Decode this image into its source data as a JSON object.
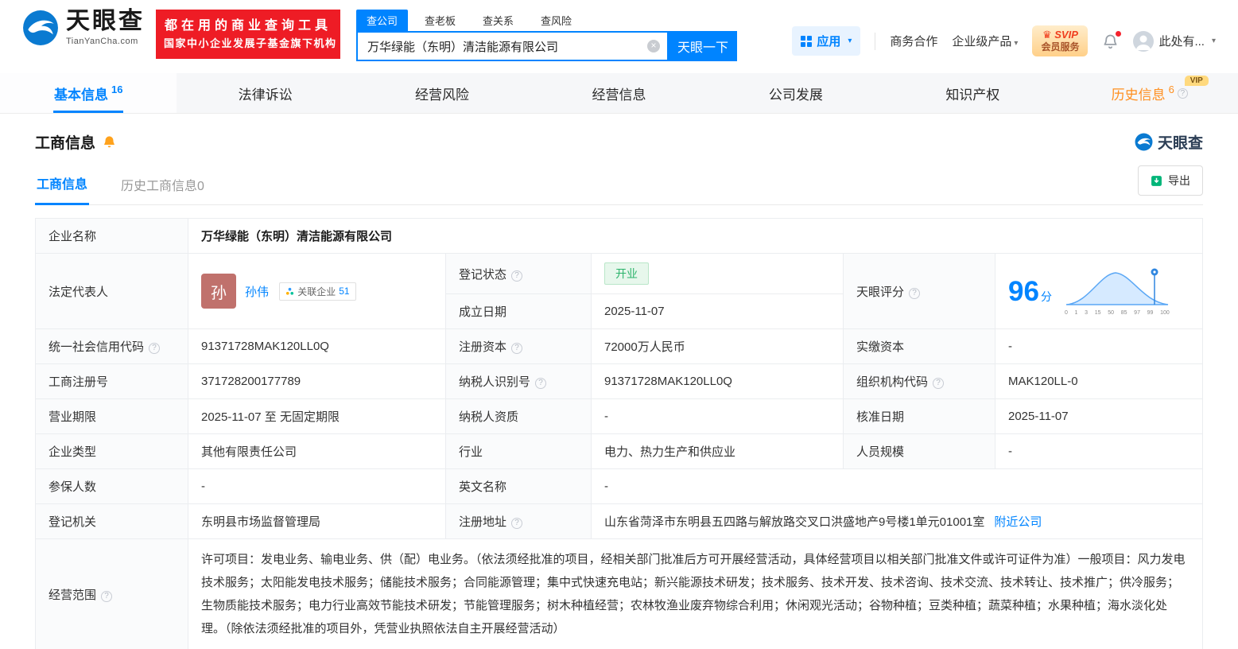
{
  "colors": {
    "primary": "#0084ff",
    "brand_red": "#ee1c25",
    "status_green": "#2bb36b",
    "history_orange": "#ff8f1f"
  },
  "header": {
    "brand": "天眼查",
    "brand_domain": "TianYanCha.com",
    "promo_line1": "都在用的商业查询工具",
    "promo_line2": "国家中小企业发展子基金旗下机构",
    "search_tabs": [
      {
        "label": "查公司"
      },
      {
        "label": "查老板"
      },
      {
        "label": "查关系"
      },
      {
        "label": "查风险"
      }
    ],
    "search_value": "万华绿能（东明）清洁能源有限公司",
    "search_button": "天眼一下",
    "apps_label": "应用",
    "biz_coop": "商务合作",
    "enterprise_products": "企业级产品",
    "svip_top": "SVIP",
    "svip_bottom": "会员服务",
    "username": "此处有..."
  },
  "main_tabs": [
    {
      "label": "基本信息",
      "count": "16"
    },
    {
      "label": "法律诉讼"
    },
    {
      "label": "经营风险"
    },
    {
      "label": "经营信息"
    },
    {
      "label": "公司发展"
    },
    {
      "label": "知识产权"
    },
    {
      "label": "历史信息",
      "count": "6",
      "vip": "VIP"
    }
  ],
  "section": {
    "title": "工商信息",
    "watermark": "天眼查",
    "subtabs": [
      {
        "label": "工商信息"
      },
      {
        "label": "历史工商信息0"
      }
    ],
    "export_label": "导出"
  },
  "table": {
    "company_name": {
      "label": "企业名称",
      "value": "万华绿能（东明）清洁能源有限公司"
    },
    "legal_rep": {
      "label": "法定代表人",
      "avatar": "孙",
      "name": "孙伟",
      "related_label": "关联企业",
      "related_count": "51"
    },
    "reg_status": {
      "label": "登记状态",
      "value": "开业"
    },
    "establish_date": {
      "label": "成立日期",
      "value": "2025-11-07"
    },
    "score": {
      "label": "天眼评分",
      "value": "96",
      "unit": "分",
      "axis": [
        "0",
        "1",
        "3",
        "15",
        "50",
        "85",
        "97",
        "99",
        "100"
      ]
    },
    "credit_code": {
      "label": "统一社会信用代码",
      "value": "91371728MAK120LL0Q"
    },
    "reg_capital": {
      "label": "注册资本",
      "value": "72000万人民币"
    },
    "paid_capital": {
      "label": "实缴资本",
      "value": "-"
    },
    "reg_number": {
      "label": "工商注册号",
      "value": "371728200177789"
    },
    "taxpayer_id": {
      "label": "纳税人识别号",
      "value": "91371728MAK120LL0Q"
    },
    "org_code": {
      "label": "组织机构代码",
      "value": "MAK120LL-0"
    },
    "business_term": {
      "label": "营业期限",
      "value": "2025-11-07 至 无固定期限"
    },
    "taxpayer_quality": {
      "label": "纳税人资质",
      "value": "-"
    },
    "approval_date": {
      "label": "核准日期",
      "value": "2025-11-07"
    },
    "company_type": {
      "label": "企业类型",
      "value": "其他有限责任公司"
    },
    "industry": {
      "label": "行业",
      "value": "电力、热力生产和供应业"
    },
    "staff_size": {
      "label": "人员规模",
      "value": "-"
    },
    "insured_count": {
      "label": "参保人数",
      "value": "-"
    },
    "english_name": {
      "label": "英文名称",
      "value": "-"
    },
    "reg_authority": {
      "label": "登记机关",
      "value": "东明县市场监督管理局"
    },
    "reg_address": {
      "label": "注册地址",
      "value": "山东省菏泽市东明县五四路与解放路交叉口洪盛地产9号楼1单元01001室",
      "nearby_link": "附近公司"
    },
    "business_scope": {
      "label": "经营范围",
      "value": "许可项目：发电业务、输电业务、供（配）电业务。（依法须经批准的项目，经相关部门批准后方可开展经营活动，具体经营项目以相关部门批准文件或许可证件为准）一般项目：风力发电技术服务；太阳能发电技术服务；储能技术服务；合同能源管理；集中式快速充电站；新兴能源技术研发；技术服务、技术开发、技术咨询、技术交流、技术转让、技术推广；供冷服务；生物质能技术服务；电力行业高效节能技术研发；节能管理服务；树木种植经营；农林牧渔业废弃物综合利用；休闲观光活动；谷物种植；豆类种植；蔬菜种植；水果种植；海水淡化处理。（除依法须经批准的项目外，凭营业执照依法自主开展经营活动）"
    }
  }
}
